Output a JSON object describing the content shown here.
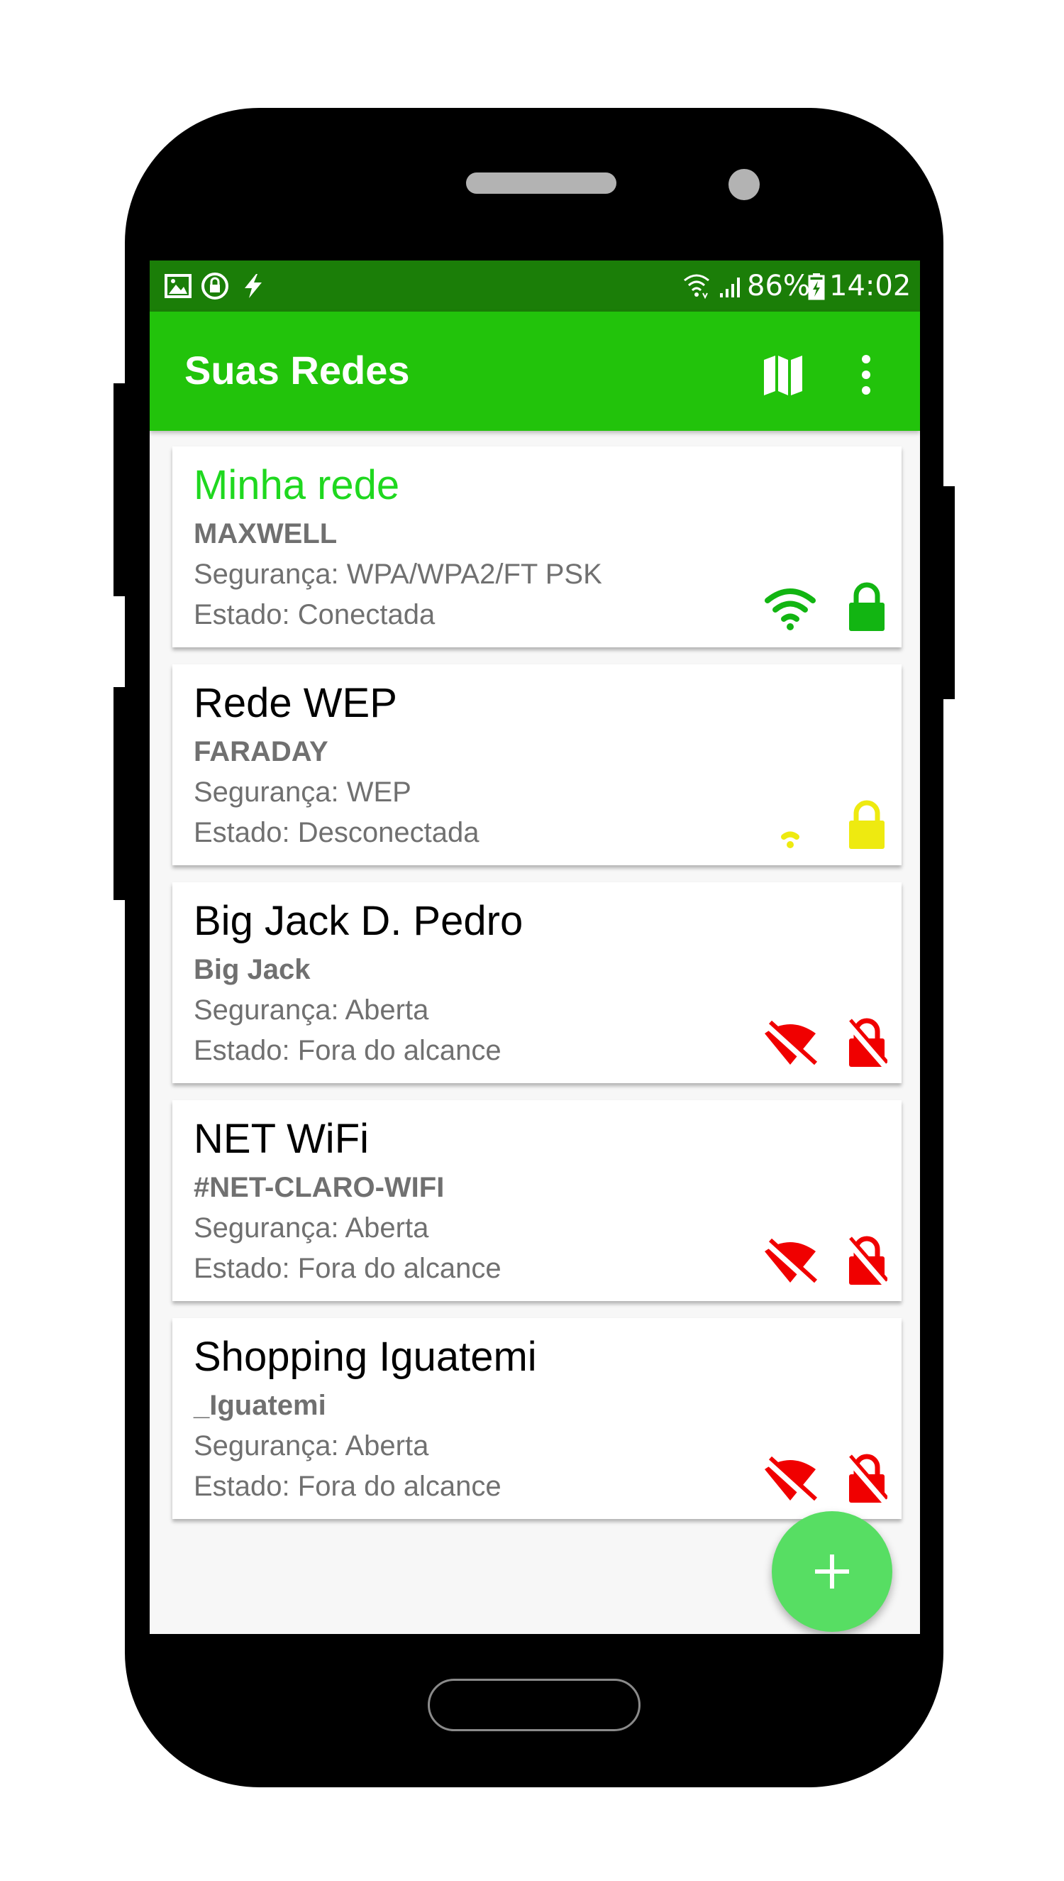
{
  "status_bar": {
    "battery": "86%",
    "time": "14:02",
    "icons": [
      "image-icon",
      "lock-circle-icon",
      "bolt-icon",
      "wifi-icon",
      "signal-icon",
      "battery-charging-icon"
    ]
  },
  "app_bar": {
    "title": "Suas Redes",
    "actions": [
      "map-icon",
      "more-vert-icon"
    ]
  },
  "networks": [
    {
      "name": "Minha rede",
      "ssid": "MAXWELL",
      "security": "Segurança: WPA/WPA2/FT PSK",
      "state": "Estado: Conectada",
      "connected": true,
      "wifi_icon": "wifi-strong-icon",
      "wifi_color": "#12b512",
      "lock_icon": "lock-icon",
      "lock_color": "#12b512"
    },
    {
      "name": "Rede WEP",
      "ssid": "FARADAY",
      "security": "Segurança: WEP",
      "state": "Estado: Desconectada",
      "connected": false,
      "wifi_icon": "wifi-weak-icon",
      "wifi_color": "#eeea10",
      "lock_icon": "lock-icon",
      "lock_color": "#eeea10"
    },
    {
      "name": "Big Jack D. Pedro",
      "ssid": "Big Jack",
      "security": "Segurança: Aberta",
      "state": "Estado: Fora do alcance",
      "connected": false,
      "wifi_icon": "wifi-off-icon",
      "wifi_color": "#f00000",
      "lock_icon": "lock-open-off-icon",
      "lock_color": "#f00000"
    },
    {
      "name": "NET WiFi",
      "ssid": "#NET-CLARO-WIFI",
      "security": "Segurança: Aberta",
      "state": "Estado: Fora do alcance",
      "connected": false,
      "wifi_icon": "wifi-off-icon",
      "wifi_color": "#f00000",
      "lock_icon": "lock-open-off-icon",
      "lock_color": "#f00000"
    },
    {
      "name": "Shopping Iguatemi",
      "ssid": "_Iguatemi",
      "security": "Segurança: Aberta",
      "state": "Estado: Fora do alcance",
      "connected": false,
      "wifi_icon": "wifi-off-icon",
      "wifi_color": "#f00000",
      "lock_icon": "lock-open-off-icon",
      "lock_color": "#f00000"
    }
  ],
  "fab": {
    "icon": "add-icon",
    "color": "#57de63"
  },
  "colors": {
    "status_bar": "#1b7e08",
    "app_bar": "#22c30b",
    "connected_text": "#1fd81f"
  }
}
